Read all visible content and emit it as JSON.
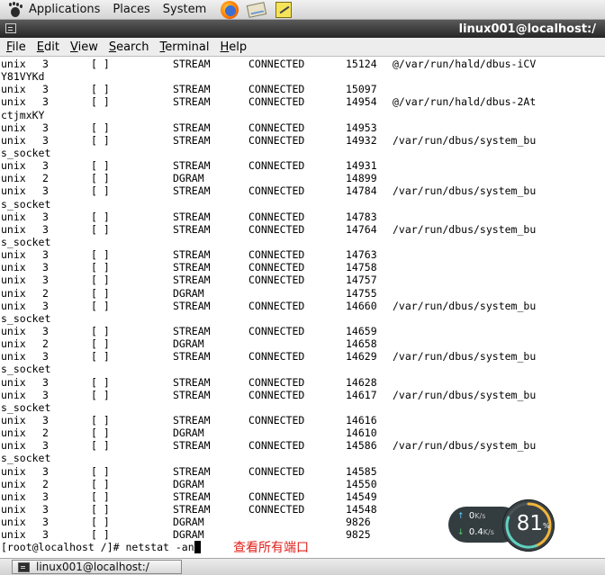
{
  "top_panel": {
    "menus": [
      "Applications",
      "Places",
      "System"
    ],
    "launchers": [
      "firefox-icon",
      "mail-icon",
      "notes-icon"
    ]
  },
  "window": {
    "title": "linux001@localhost:/"
  },
  "menu_bar": {
    "items": [
      {
        "mnemonic": "F",
        "rest": "ile"
      },
      {
        "mnemonic": "E",
        "rest": "dit"
      },
      {
        "mnemonic": "V",
        "rest": "iew"
      },
      {
        "mnemonic": "S",
        "rest": "earch"
      },
      {
        "mnemonic": "T",
        "rest": "erminal"
      },
      {
        "mnemonic": "H",
        "rest": "elp"
      }
    ]
  },
  "terminal": {
    "lines": [
      {
        "proto": "unix",
        "refcnt": "3",
        "flags": "[ ]",
        "type": "STREAM",
        "state": "CONNECTED",
        "inode": "15124",
        "path": "@/var/run/hald/dbus-iCV"
      },
      {
        "wrap": "Y81VYKd"
      },
      {
        "proto": "unix",
        "refcnt": "3",
        "flags": "[ ]",
        "type": "STREAM",
        "state": "CONNECTED",
        "inode": "15097",
        "path": ""
      },
      {
        "proto": "unix",
        "refcnt": "3",
        "flags": "[ ]",
        "type": "STREAM",
        "state": "CONNECTED",
        "inode": "14954",
        "path": "@/var/run/hald/dbus-2At"
      },
      {
        "wrap": "ctjmxKY"
      },
      {
        "proto": "unix",
        "refcnt": "3",
        "flags": "[ ]",
        "type": "STREAM",
        "state": "CONNECTED",
        "inode": "14953",
        "path": ""
      },
      {
        "proto": "unix",
        "refcnt": "3",
        "flags": "[ ]",
        "type": "STREAM",
        "state": "CONNECTED",
        "inode": "14932",
        "path": "/var/run/dbus/system_bu"
      },
      {
        "wrap": "s_socket"
      },
      {
        "proto": "unix",
        "refcnt": "3",
        "flags": "[ ]",
        "type": "STREAM",
        "state": "CONNECTED",
        "inode": "14931",
        "path": ""
      },
      {
        "proto": "unix",
        "refcnt": "2",
        "flags": "[ ]",
        "type": "DGRAM",
        "state": "",
        "inode": "14899",
        "path": ""
      },
      {
        "proto": "unix",
        "refcnt": "3",
        "flags": "[ ]",
        "type": "STREAM",
        "state": "CONNECTED",
        "inode": "14784",
        "path": "/var/run/dbus/system_bu"
      },
      {
        "wrap": "s_socket"
      },
      {
        "proto": "unix",
        "refcnt": "3",
        "flags": "[ ]",
        "type": "STREAM",
        "state": "CONNECTED",
        "inode": "14783",
        "path": ""
      },
      {
        "proto": "unix",
        "refcnt": "3",
        "flags": "[ ]",
        "type": "STREAM",
        "state": "CONNECTED",
        "inode": "14764",
        "path": "/var/run/dbus/system_bu"
      },
      {
        "wrap": "s_socket"
      },
      {
        "proto": "unix",
        "refcnt": "3",
        "flags": "[ ]",
        "type": "STREAM",
        "state": "CONNECTED",
        "inode": "14763",
        "path": ""
      },
      {
        "proto": "unix",
        "refcnt": "3",
        "flags": "[ ]",
        "type": "STREAM",
        "state": "CONNECTED",
        "inode": "14758",
        "path": ""
      },
      {
        "proto": "unix",
        "refcnt": "3",
        "flags": "[ ]",
        "type": "STREAM",
        "state": "CONNECTED",
        "inode": "14757",
        "path": ""
      },
      {
        "proto": "unix",
        "refcnt": "2",
        "flags": "[ ]",
        "type": "DGRAM",
        "state": "",
        "inode": "14755",
        "path": ""
      },
      {
        "proto": "unix",
        "refcnt": "3",
        "flags": "[ ]",
        "type": "STREAM",
        "state": "CONNECTED",
        "inode": "14660",
        "path": "/var/run/dbus/system_bu"
      },
      {
        "wrap": "s_socket"
      },
      {
        "proto": "unix",
        "refcnt": "3",
        "flags": "[ ]",
        "type": "STREAM",
        "state": "CONNECTED",
        "inode": "14659",
        "path": ""
      },
      {
        "proto": "unix",
        "refcnt": "2",
        "flags": "[ ]",
        "type": "DGRAM",
        "state": "",
        "inode": "14658",
        "path": ""
      },
      {
        "proto": "unix",
        "refcnt": "3",
        "flags": "[ ]",
        "type": "STREAM",
        "state": "CONNECTED",
        "inode": "14629",
        "path": "/var/run/dbus/system_bu"
      },
      {
        "wrap": "s_socket"
      },
      {
        "proto": "unix",
        "refcnt": "3",
        "flags": "[ ]",
        "type": "STREAM",
        "state": "CONNECTED",
        "inode": "14628",
        "path": ""
      },
      {
        "proto": "unix",
        "refcnt": "3",
        "flags": "[ ]",
        "type": "STREAM",
        "state": "CONNECTED",
        "inode": "14617",
        "path": "/var/run/dbus/system_bu"
      },
      {
        "wrap": "s_socket"
      },
      {
        "proto": "unix",
        "refcnt": "3",
        "flags": "[ ]",
        "type": "STREAM",
        "state": "CONNECTED",
        "inode": "14616",
        "path": ""
      },
      {
        "proto": "unix",
        "refcnt": "2",
        "flags": "[ ]",
        "type": "DGRAM",
        "state": "",
        "inode": "14610",
        "path": ""
      },
      {
        "proto": "unix",
        "refcnt": "3",
        "flags": "[ ]",
        "type": "STREAM",
        "state": "CONNECTED",
        "inode": "14586",
        "path": "/var/run/dbus/system_bu"
      },
      {
        "wrap": "s_socket"
      },
      {
        "proto": "unix",
        "refcnt": "3",
        "flags": "[ ]",
        "type": "STREAM",
        "state": "CONNECTED",
        "inode": "14585",
        "path": ""
      },
      {
        "proto": "unix",
        "refcnt": "2",
        "flags": "[ ]",
        "type": "DGRAM",
        "state": "",
        "inode": "14550",
        "path": ""
      },
      {
        "proto": "unix",
        "refcnt": "3",
        "flags": "[ ]",
        "type": "STREAM",
        "state": "CONNECTED",
        "inode": "14549",
        "path": ""
      },
      {
        "proto": "unix",
        "refcnt": "3",
        "flags": "[ ]",
        "type": "STREAM",
        "state": "CONNECTED",
        "inode": "14548",
        "path": ""
      },
      {
        "proto": "unix",
        "refcnt": "3",
        "flags": "[ ]",
        "type": "DGRAM",
        "state": "",
        "inode": "9826",
        "path": ""
      },
      {
        "proto": "unix",
        "refcnt": "3",
        "flags": "[ ]",
        "type": "DGRAM",
        "state": "",
        "inode": "9825",
        "path": ""
      }
    ],
    "prompt": "[root@localhost /]# ",
    "command": "netstat -an",
    "annotation": "查看所有端口",
    "annotation_color": "#e0201b"
  },
  "net_monitor": {
    "upload_value": "0",
    "upload_unit": "K/s",
    "download_value": "0.4",
    "download_unit": "K/s",
    "usage_value": "81",
    "usage_unit": "%",
    "usage_fraction": 0.81
  },
  "taskbar": {
    "window_button": "linux001@localhost:/"
  }
}
